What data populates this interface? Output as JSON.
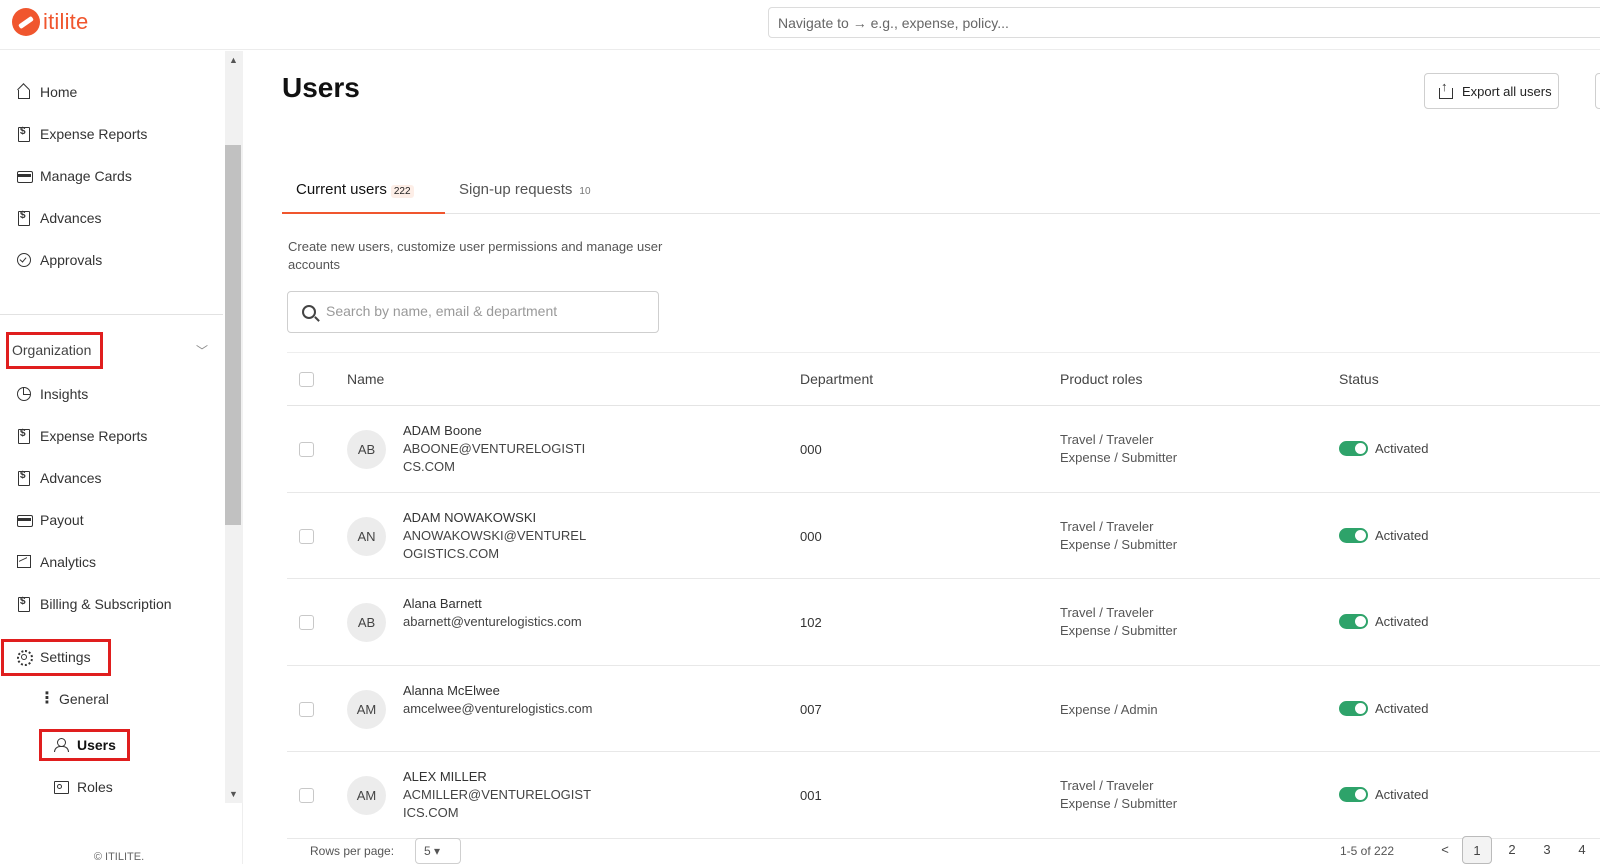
{
  "app": {
    "logo_text": "itilite",
    "nav_search_placeholder": "Navigate to → e.g., expense, policy..."
  },
  "sidebar": {
    "main_items": [
      {
        "label": "Home",
        "icon": "home-icon"
      },
      {
        "label": "Expense Reports",
        "icon": "receipt-icon"
      },
      {
        "label": "Manage Cards",
        "icon": "card-icon"
      },
      {
        "label": "Advances",
        "icon": "advance-icon"
      },
      {
        "label": "Approvals",
        "icon": "check-circle-icon"
      }
    ],
    "org_label": "Organization",
    "org_items": [
      {
        "label": "Insights",
        "icon": "pie-icon"
      },
      {
        "label": "Expense Reports",
        "icon": "receipt-icon"
      },
      {
        "label": "Advances",
        "icon": "advance-icon"
      },
      {
        "label": "Payout",
        "icon": "card-icon"
      },
      {
        "label": "Analytics",
        "icon": "chart-icon"
      },
      {
        "label": "Billing & Subscription",
        "icon": "billing-icon"
      },
      {
        "label": "Settings",
        "icon": "gear-icon"
      }
    ],
    "settings_items": [
      {
        "label": "General",
        "icon": "dots-icon"
      },
      {
        "label": "Users",
        "icon": "users-icon"
      },
      {
        "label": "Roles",
        "icon": "roles-icon"
      }
    ],
    "copyright": "© ITILITE."
  },
  "page": {
    "title": "Users",
    "export_label": "Export all users",
    "tabs": [
      {
        "label": "Current users",
        "count": "222"
      },
      {
        "label": "Sign-up requests",
        "count": "10"
      }
    ],
    "description": "Create new users, customize user permissions and manage user accounts",
    "search_placeholder": "Search by name, email & department"
  },
  "table": {
    "headers": {
      "name": "Name",
      "department": "Department",
      "roles": "Product roles",
      "status": "Status"
    },
    "rows": [
      {
        "initials": "AB",
        "name": "ADAM Boone",
        "email": "ABOONE@VENTURELOGISTICS.COM",
        "department": "000",
        "role1": "Travel / Traveler",
        "role2": "Expense / Submitter",
        "status": "Activated"
      },
      {
        "initials": "AN",
        "name": "ADAM NOWAKOWSKI",
        "email": "ANOWAKOWSKI@VENTURELOGISTICS.COM",
        "department": "000",
        "role1": "Travel / Traveler",
        "role2": "Expense / Submitter",
        "status": "Activated"
      },
      {
        "initials": "AB",
        "name": "Alana Barnett",
        "email": "abarnett@venturelogistics.com",
        "department": "102",
        "role1": "Travel / Traveler",
        "role2": "Expense / Submitter",
        "status": "Activated"
      },
      {
        "initials": "AM",
        "name": "Alanna McElwee",
        "email": "amcelwee@venturelogistics.com",
        "department": "007",
        "role1": "Expense / Admin",
        "role2": "",
        "status": "Activated"
      },
      {
        "initials": "AM",
        "name": "ALEX MILLER",
        "email": "ACMILLER@VENTURELOGISTICS.COM",
        "department": "001",
        "role1": "Travel / Traveler",
        "role2": "Expense / Submitter",
        "status": "Activated"
      }
    ]
  },
  "pagination": {
    "rows_per_page_label": "Rows per page:",
    "rows_per_page": "5",
    "range": "1-5 of 222",
    "pages": [
      "1",
      "2",
      "3",
      "4"
    ],
    "prev": "<"
  },
  "colors": {
    "accent": "#f0562e",
    "highlight": "#e01e1e",
    "toggle_on": "#2ea36a"
  }
}
